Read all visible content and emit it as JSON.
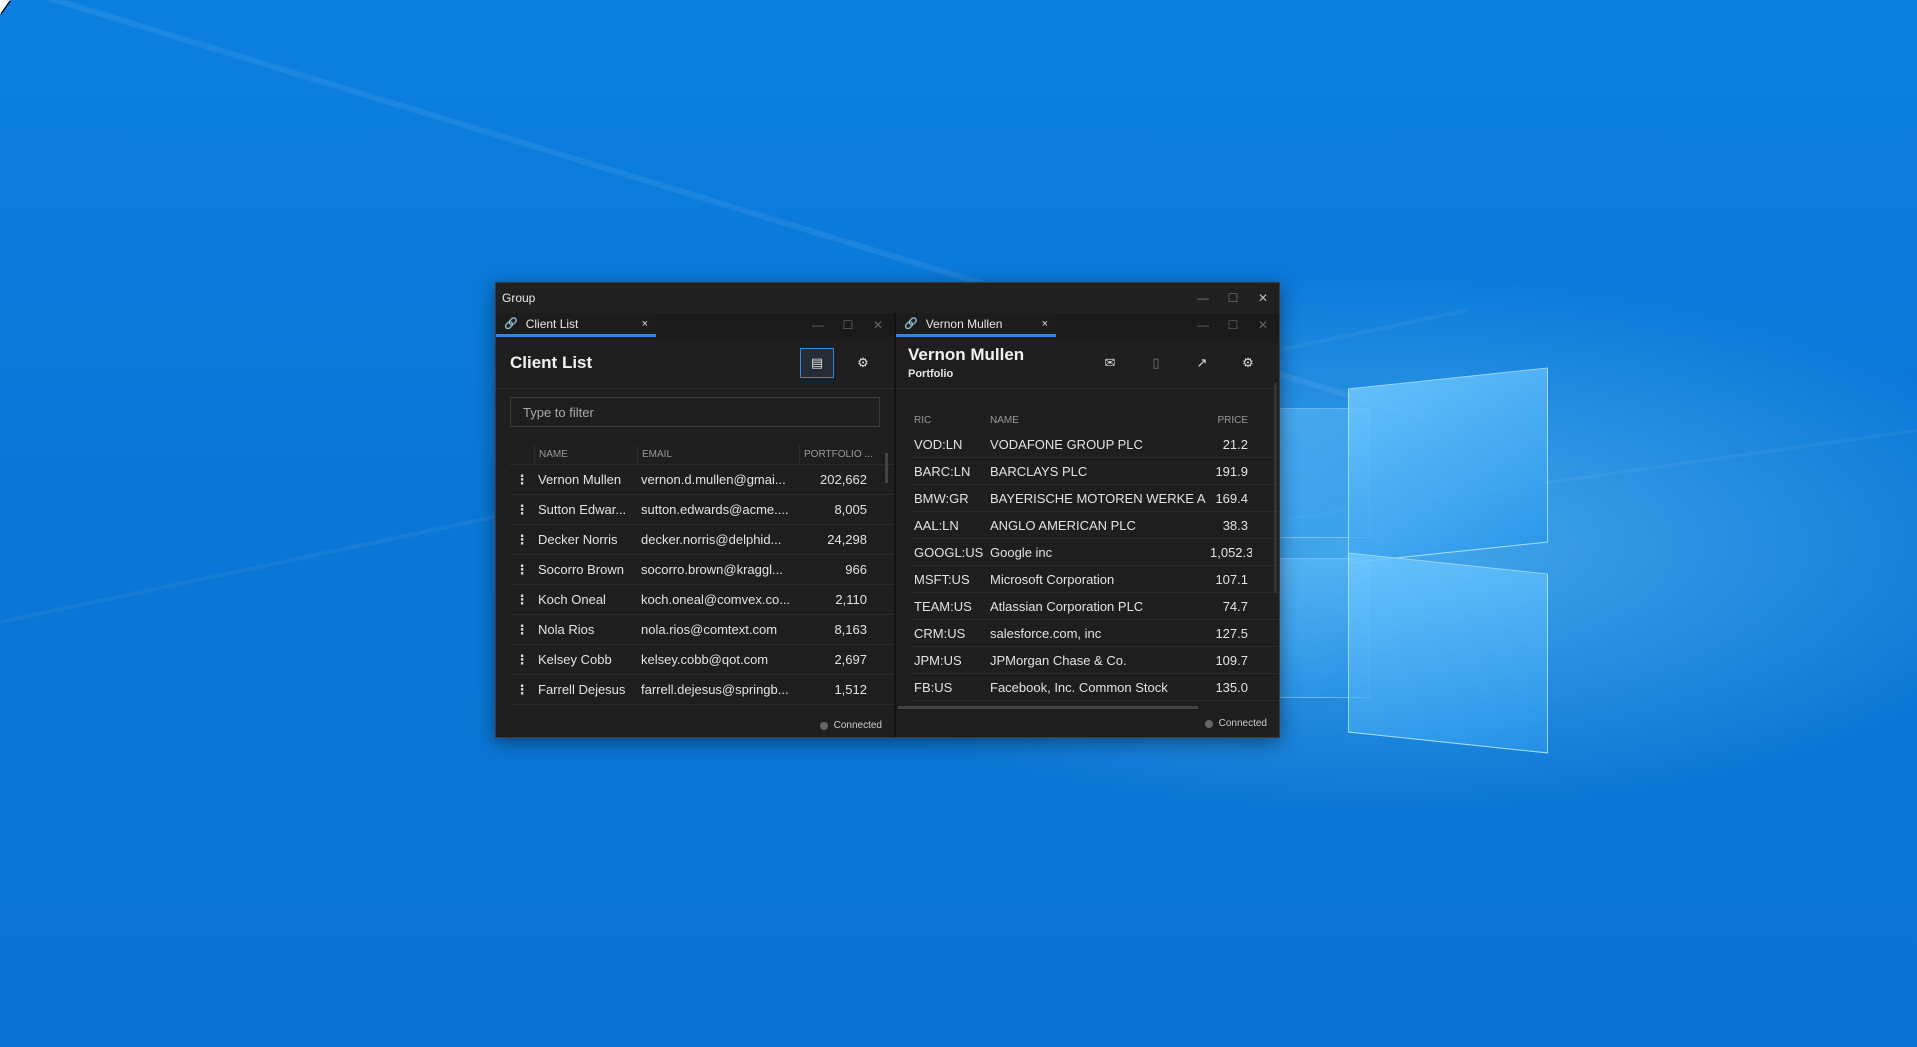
{
  "window": {
    "title": "Group"
  },
  "client_list": {
    "tab_label": "Client List",
    "heading": "Client List",
    "filter_placeholder": "Type to filter",
    "columns": [
      "NAME",
      "EMAIL",
      "PORTFOLIO ..."
    ],
    "rows": [
      {
        "name": "Vernon Mullen",
        "email": "vernon.d.mullen@gmai...",
        "portfolio": "202,662"
      },
      {
        "name": "Sutton Edwar...",
        "email": "sutton.edwards@acme....",
        "portfolio": "8,005"
      },
      {
        "name": "Decker Norris",
        "email": "decker.norris@delphid...",
        "portfolio": "24,298"
      },
      {
        "name": "Socorro Brown",
        "email": "socorro.brown@kraggl...",
        "portfolio": "966"
      },
      {
        "name": "Koch Oneal",
        "email": "koch.oneal@comvex.co...",
        "portfolio": "2,110"
      },
      {
        "name": "Nola Rios",
        "email": "nola.rios@comtext.com",
        "portfolio": "8,163"
      },
      {
        "name": "Kelsey Cobb",
        "email": "kelsey.cobb@qot.com",
        "portfolio": "2,697"
      },
      {
        "name": "Farrell Dejesus",
        "email": "farrell.dejesus@springb...",
        "portfolio": "1,512"
      }
    ],
    "status": "Connected"
  },
  "portfolio": {
    "tab_label": "Vernon Mullen",
    "heading": "Vernon Mullen",
    "subheading": "Portfolio",
    "columns": [
      "RIC",
      "NAME",
      "PRICE"
    ],
    "rows": [
      {
        "ric": "VOD:LN",
        "name": "VODAFONE GROUP PLC",
        "price": "21.2"
      },
      {
        "ric": "BARC:LN",
        "name": "BARCLAYS PLC",
        "price": "191.9"
      },
      {
        "ric": "BMW:GR",
        "name": "BAYERISCHE MOTOREN WERKE AG",
        "price": "169.4"
      },
      {
        "ric": "AAL:LN",
        "name": "ANGLO AMERICAN PLC",
        "price": "38.3"
      },
      {
        "ric": "GOOGL:US",
        "name": "Google inc",
        "price": "1,052.3"
      },
      {
        "ric": "MSFT:US",
        "name": "Microsoft Corporation",
        "price": "107.1"
      },
      {
        "ric": "TEAM:US",
        "name": "Atlassian Corporation PLC",
        "price": "74.7"
      },
      {
        "ric": "CRM:US",
        "name": "salesforce.com, inc",
        "price": "127.5"
      },
      {
        "ric": "JPM:US",
        "name": "JPMorgan Chase & Co.",
        "price": "109.7"
      },
      {
        "ric": "FB:US",
        "name": "Facebook, Inc. Common Stock",
        "price": "135.0"
      }
    ],
    "status": "Connected"
  },
  "icons": {
    "minimize": "—",
    "maximize": "☐",
    "close": "✕",
    "tab_close": "×",
    "link": "🔗",
    "grid": "▤",
    "gear": "⚙",
    "mail": "✉",
    "doc": "▯",
    "chart": "↗",
    "menu": "⋮"
  },
  "colors": {
    "accent": "#2d8ae0",
    "background": "#1e1e1e",
    "desktop": "#0a78d7"
  }
}
